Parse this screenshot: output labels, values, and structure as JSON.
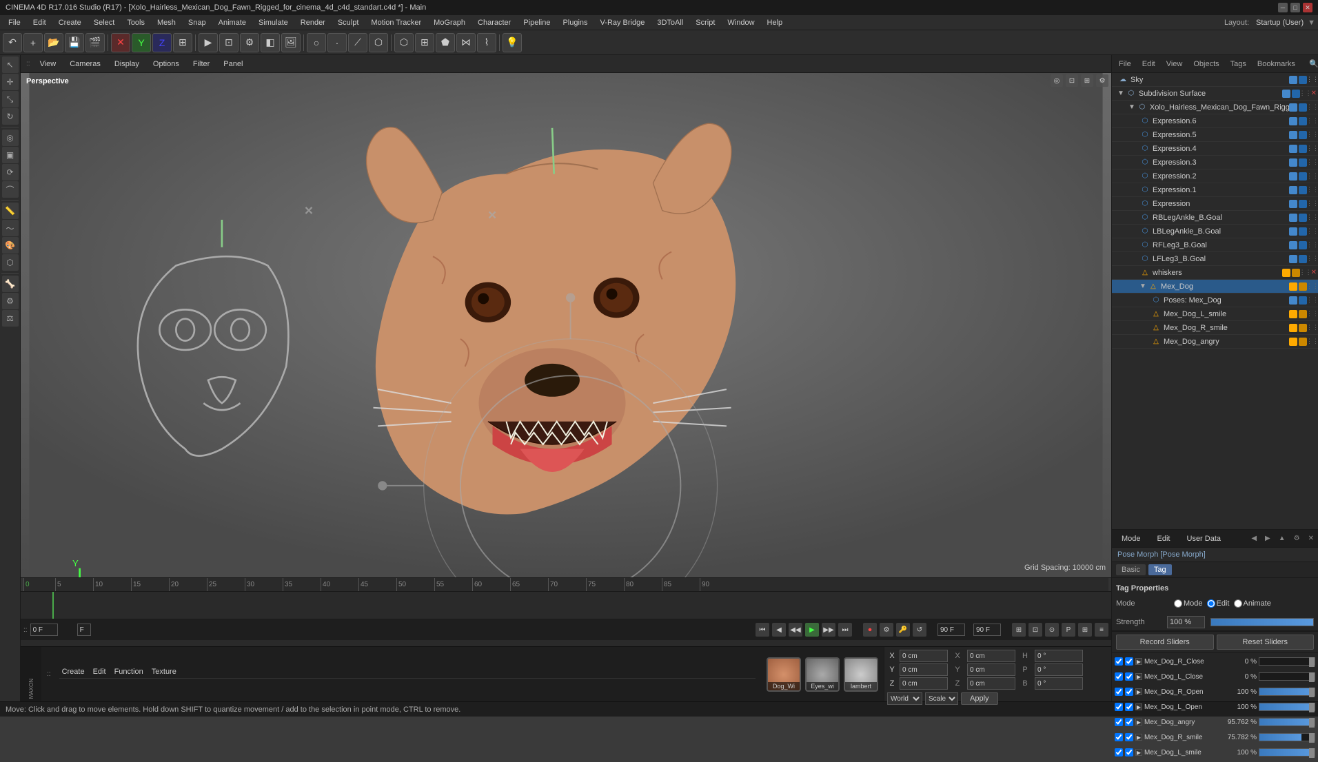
{
  "app": {
    "title": "CINEMA 4D R17.016 Studio (R17) - [Xolo_Hairless_Mexican_Dog_Fawn_Rigged_for_cinema_4d_c4d_standart.c4d *] - Main",
    "layout": "Startup (User)"
  },
  "menu": {
    "file": "File",
    "edit": "Edit",
    "create": "Create",
    "select": "Select",
    "tools": "Tools",
    "mesh": "Mesh",
    "snap": "Snap",
    "animate": "Animate",
    "simulate": "Simulate",
    "render": "Render",
    "sculpt": "Sculpt",
    "motion_tracker": "Motion Tracker",
    "mograph": "MoGraph",
    "character": "Character",
    "pipeline": "Pipeline",
    "plugins": "Plugins",
    "v_ray": "V-Ray Bridge",
    "3dtoall": "3DToAll",
    "script": "Script",
    "window": "Window",
    "help": "Help"
  },
  "viewport": {
    "label": "Perspective",
    "menus": [
      "View",
      "Cameras",
      "Display",
      "Options",
      "Filter",
      "Panel"
    ],
    "grid_spacing": "Grid Spacing: 10000 cm"
  },
  "object_manager": {
    "menus": [
      "File",
      "Edit",
      "View",
      "Objects",
      "Tags",
      "Bookmarks"
    ],
    "items": [
      {
        "id": "sky",
        "name": "Sky",
        "indent": 0,
        "icon": "sky",
        "icon_color": "#88aacc",
        "icon_char": "☁",
        "tags": []
      },
      {
        "id": "subdivision_surface",
        "name": "Subdivision Surface",
        "indent": 0,
        "icon": "subdiv",
        "icon_color": "#88aacc",
        "icon_char": "⬡",
        "tags": []
      },
      {
        "id": "xolo_dog_rigged",
        "name": "Xolo_Hairless_Mexican_Dog_Fawn_Rigged",
        "indent": 1,
        "icon": "object",
        "icon_color": "#88aacc",
        "icon_char": "⬡",
        "tags": []
      },
      {
        "id": "expression_6",
        "name": "Expression.6",
        "indent": 2,
        "icon": "expr",
        "icon_color": "#4488cc",
        "icon_char": "⬡",
        "tags": []
      },
      {
        "id": "expression_5",
        "name": "Expression.5",
        "indent": 2,
        "icon": "expr",
        "icon_color": "#4488cc",
        "icon_char": "⬡",
        "tags": []
      },
      {
        "id": "expression_4",
        "name": "Expression.4",
        "indent": 2,
        "icon": "expr",
        "icon_color": "#4488cc",
        "icon_char": "⬡",
        "tags": []
      },
      {
        "id": "expression_3",
        "name": "Expression.3",
        "indent": 2,
        "icon": "expr",
        "icon_color": "#4488cc",
        "icon_char": "⬡",
        "tags": []
      },
      {
        "id": "expression_2",
        "name": "Expression.2",
        "indent": 2,
        "icon": "expr",
        "icon_color": "#4488cc",
        "icon_char": "⬡",
        "tags": []
      },
      {
        "id": "expression_1",
        "name": "Expression.1",
        "indent": 2,
        "icon": "expr",
        "icon_color": "#4488cc",
        "icon_char": "⬡",
        "tags": []
      },
      {
        "id": "expression",
        "name": "Expression",
        "indent": 2,
        "icon": "expr",
        "icon_color": "#4488cc",
        "icon_char": "⬡",
        "tags": []
      },
      {
        "id": "rb_leg_ankle_b_goal",
        "name": "RBLegAnkle_B.Goal",
        "indent": 2,
        "icon": "null",
        "icon_color": "#4488cc",
        "icon_char": "⬡",
        "tags": []
      },
      {
        "id": "lb_leg_ankle_b_goal",
        "name": "LBLegAnkle_B.Goal",
        "indent": 2,
        "icon": "null",
        "icon_color": "#4488cc",
        "icon_char": "⬡",
        "tags": []
      },
      {
        "id": "rf_leg3_b_goal",
        "name": "RFLeg3_B.Goal",
        "indent": 2,
        "icon": "null",
        "icon_color": "#4488cc",
        "icon_char": "⬡",
        "tags": []
      },
      {
        "id": "lf_leg3_b_goal",
        "name": "LFLeg3_B.Goal",
        "indent": 2,
        "icon": "null",
        "icon_color": "#4488cc",
        "icon_char": "⬡",
        "tags": []
      },
      {
        "id": "whiskers",
        "name": "whiskers",
        "indent": 2,
        "icon": "mesh",
        "icon_color": "#ffaa00",
        "icon_char": "△",
        "tags": []
      },
      {
        "id": "mex_dog",
        "name": "Mex_Dog",
        "indent": 2,
        "icon": "mesh",
        "icon_color": "#ffaa00",
        "icon_char": "△",
        "tags": [],
        "selected": true
      },
      {
        "id": "poses_mex_dog",
        "name": "Poses: Mex_Dog",
        "indent": 3,
        "icon": "pose",
        "icon_color": "#4488cc",
        "icon_char": "⬡",
        "tags": []
      },
      {
        "id": "mex_dog_l_smile",
        "name": "Mex_Dog_L_smile",
        "indent": 3,
        "icon": "mesh",
        "icon_color": "#ffaa00",
        "icon_char": "△",
        "tags": []
      },
      {
        "id": "mex_dog_r_smile",
        "name": "Mex_Dog_R_smile",
        "indent": 3,
        "icon": "mesh",
        "icon_color": "#ffaa00",
        "icon_char": "△",
        "tags": []
      },
      {
        "id": "mex_dog_angry",
        "name": "Mex_Dog_angry",
        "indent": 3,
        "icon": "mesh",
        "icon_color": "#ffaa00",
        "icon_char": "△",
        "tags": []
      }
    ]
  },
  "properties": {
    "mode_label": "Mode",
    "edit_label": "Edit",
    "user_data_label": "User Data",
    "pose_morph_title": "Pose Morph [Pose Morph]",
    "basic_tab": "Basic",
    "tag_tab": "Tag",
    "tag_properties_label": "Tag Properties",
    "mode_options": [
      "Mode",
      "Edit",
      "Animate"
    ],
    "strength_label": "Strength",
    "strength_value": "100 %",
    "record_sliders_btn": "Record Sliders",
    "reset_sliders_btn": "Reset Sliders",
    "sliders": [
      {
        "name": "Mex_Dog_R_Close",
        "value": "0 %",
        "pct": 0
      },
      {
        "name": "Mex_Dog_L_Close",
        "value": "0 %",
        "pct": 0
      },
      {
        "name": "Mex_Dog_R_Open",
        "value": "100 %",
        "pct": 100
      },
      {
        "name": "Mex_Dog_L_Open",
        "value": "100 %",
        "pct": 100
      },
      {
        "name": "Mex_Dog_angry",
        "value": "95.762 %",
        "pct": 95.762
      },
      {
        "name": "Mex_Dog_R_smile",
        "value": "75.782 %",
        "pct": 75.782
      },
      {
        "name": "Mex_Dog_L_smile",
        "value": "100 %",
        "pct": 100
      }
    ]
  },
  "timeline": {
    "ticks": [
      "0",
      "5",
      "10",
      "15",
      "20",
      "25",
      "30",
      "35",
      "40",
      "45",
      "50",
      "55",
      "60",
      "65",
      "70",
      "75",
      "80",
      "85",
      "90"
    ],
    "current_frame": "0 F",
    "end_frame": "90 F",
    "frame_display": "0 F",
    "frame_end_display": "90 F"
  },
  "coordinates": {
    "x_pos": "0 cm",
    "y_pos": "0 cm",
    "z_pos": "0 cm",
    "h_rot": "0 °",
    "p_rot": "0 °",
    "b_rot": "0 °",
    "x_size": "0 cm",
    "y_size": "0 cm",
    "z_size": "0 cm",
    "world_label": "World",
    "scale_label": "Scale",
    "apply_label": "Apply"
  },
  "materials": [
    {
      "name": "Dog_Wi",
      "color": "#c8a070"
    },
    {
      "name": "Eyes_wi",
      "color": "#888888"
    },
    {
      "name": "lambert",
      "color": "#aaaaaa"
    }
  ],
  "statusbar": {
    "text": "Move: Click and drag to move elements. Hold down SHIFT to quantize movement / add to the selection in point mode, CTRL to remove."
  },
  "icons": {
    "arrow": "▶",
    "back": "◀",
    "stop": "■",
    "play": "▶",
    "fwd": "▶▶",
    "rewind": "◀◀",
    "key": "🔑",
    "record": "⏺",
    "loop": "↺"
  }
}
